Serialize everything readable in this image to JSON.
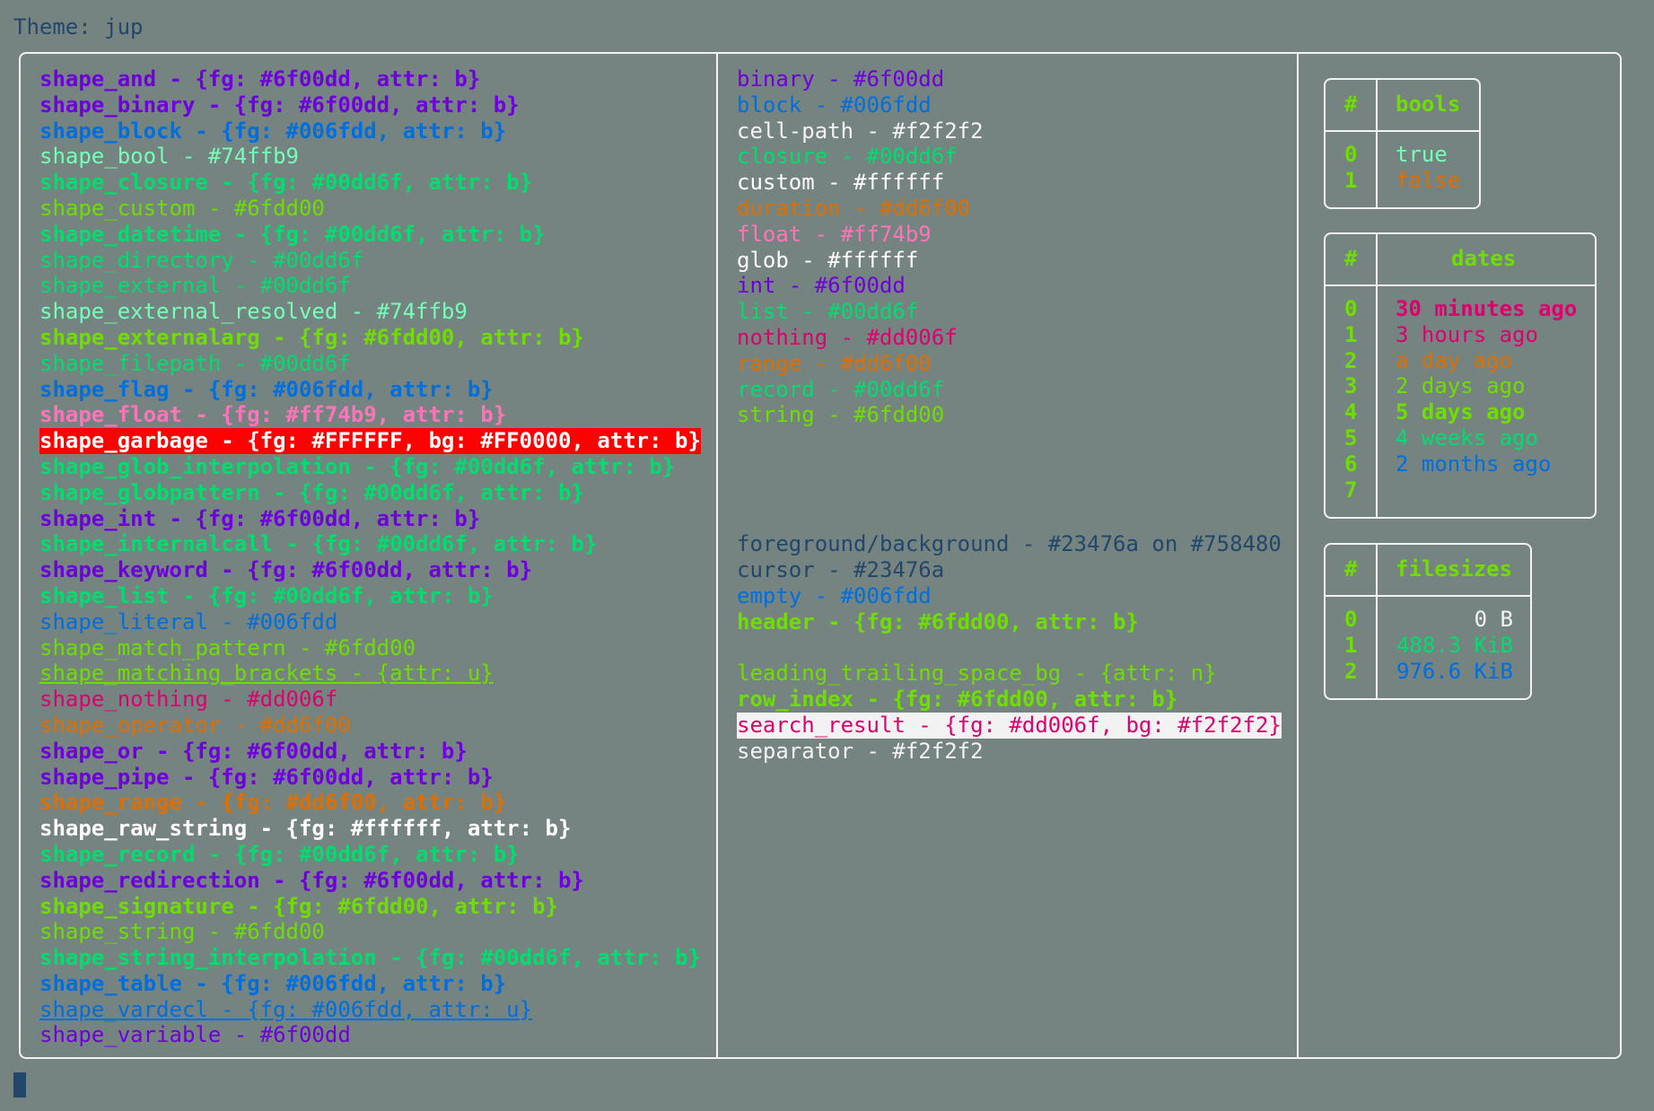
{
  "theme_line": "Theme: jup",
  "left_items": [
    {
      "text": "shape_and - {fg: #6f00dd, attr: b}",
      "color": "#6f00dd",
      "bold": true
    },
    {
      "text": "shape_binary - {fg: #6f00dd, attr: b}",
      "color": "#6f00dd",
      "bold": true
    },
    {
      "text": "shape_block - {fg: #006fdd, attr: b}",
      "color": "#006fdd",
      "bold": true
    },
    {
      "text": "shape_bool - #74ffb9",
      "color": "#74ffb9"
    },
    {
      "text": "shape_closure - {fg: #00dd6f, attr: b}",
      "color": "#00dd6f",
      "bold": true
    },
    {
      "text": "shape_custom - #6fdd00",
      "color": "#6fdd00"
    },
    {
      "text": "shape_datetime - {fg: #00dd6f, attr: b}",
      "color": "#00dd6f",
      "bold": true
    },
    {
      "text": "shape_directory - #00dd6f",
      "color": "#00dd6f"
    },
    {
      "text": "shape_external - #00dd6f",
      "color": "#00dd6f"
    },
    {
      "text": "shape_external_resolved - #74ffb9",
      "color": "#74ffb9"
    },
    {
      "text": "shape_externalarg - {fg: #6fdd00, attr: b}",
      "color": "#6fdd00",
      "bold": true
    },
    {
      "text": "shape_filepath - #00dd6f",
      "color": "#00dd6f"
    },
    {
      "text": "shape_flag - {fg: #006fdd, attr: b}",
      "color": "#006fdd",
      "bold": true
    },
    {
      "text": "shape_float - {fg: #ff74b9, attr: b}",
      "color": "#ff74b9",
      "bold": true
    },
    {
      "text": "shape_garbage - {fg: #FFFFFF, bg: #FF0000, attr: b}",
      "color": "#FFFFFF",
      "bg": "#FF0000",
      "bold": true
    },
    {
      "text": "shape_glob_interpolation - {fg: #00dd6f, attr: b}",
      "color": "#00dd6f",
      "bold": true
    },
    {
      "text": "shape_globpattern - {fg: #00dd6f, attr: b}",
      "color": "#00dd6f",
      "bold": true
    },
    {
      "text": "shape_int - {fg: #6f00dd, attr: b}",
      "color": "#6f00dd",
      "bold": true
    },
    {
      "text": "shape_internalcall - {fg: #00dd6f, attr: b}",
      "color": "#00dd6f",
      "bold": true
    },
    {
      "text": "shape_keyword - {fg: #6f00dd, attr: b}",
      "color": "#6f00dd",
      "bold": true
    },
    {
      "text": "shape_list - {fg: #00dd6f, attr: b}",
      "color": "#00dd6f",
      "bold": true
    },
    {
      "text": "shape_literal - #006fdd",
      "color": "#006fdd"
    },
    {
      "text": "shape_match_pattern - #6fdd00",
      "color": "#6fdd00"
    },
    {
      "text": "shape_matching_brackets - {attr: u}",
      "color": "#6fdd00",
      "underline": true
    },
    {
      "text": "shape_nothing - #dd006f",
      "color": "#dd006f"
    },
    {
      "text": "shape_operator - #dd6f00",
      "color": "#dd6f00"
    },
    {
      "text": "shape_or - {fg: #6f00dd, attr: b}",
      "color": "#6f00dd",
      "bold": true
    },
    {
      "text": "shape_pipe - {fg: #6f00dd, attr: b}",
      "color": "#6f00dd",
      "bold": true
    },
    {
      "text": "shape_range - {fg: #dd6f00, attr: b}",
      "color": "#dd6f00",
      "bold": true
    },
    {
      "text": "shape_raw_string - {fg: #ffffff, attr: b}",
      "color": "#ffffff",
      "bold": true
    },
    {
      "text": "shape_record - {fg: #00dd6f, attr: b}",
      "color": "#00dd6f",
      "bold": true
    },
    {
      "text": "shape_redirection - {fg: #6f00dd, attr: b}",
      "color": "#6f00dd",
      "bold": true
    },
    {
      "text": "shape_signature - {fg: #6fdd00, attr: b}",
      "color": "#6fdd00",
      "bold": true
    },
    {
      "text": "shape_string - #6fdd00",
      "color": "#6fdd00"
    },
    {
      "text": "shape_string_interpolation - {fg: #00dd6f, attr: b}",
      "color": "#00dd6f",
      "bold": true
    },
    {
      "text": "shape_table - {fg: #006fdd, attr: b}",
      "color": "#006fdd",
      "bold": true
    },
    {
      "text": "shape_vardecl - {fg: #006fdd, attr: u}",
      "color": "#006fdd",
      "underline": true
    },
    {
      "text": "shape_variable - #6f00dd",
      "color": "#6f00dd"
    }
  ],
  "middle_items": [
    {
      "text": "binary - #6f00dd",
      "color": "#6f00dd"
    },
    {
      "text": "block - #006fdd",
      "color": "#006fdd"
    },
    {
      "text": "cell-path - #f2f2f2",
      "color": "#f2f2f2"
    },
    {
      "text": "closure - #00dd6f",
      "color": "#00dd6f"
    },
    {
      "text": "custom - #ffffff",
      "color": "#ffffff"
    },
    {
      "text": "duration - #dd6f00",
      "color": "#dd6f00"
    },
    {
      "text": "float - #ff74b9",
      "color": "#ff74b9"
    },
    {
      "text": "glob - #ffffff",
      "color": "#ffffff"
    },
    {
      "text": "int - #6f00dd",
      "color": "#6f00dd"
    },
    {
      "text": "list - #00dd6f",
      "color": "#00dd6f"
    },
    {
      "text": "nothing - #dd006f",
      "color": "#dd006f"
    },
    {
      "text": "range - #dd6f00",
      "color": "#dd6f00"
    },
    {
      "text": "record - #00dd6f",
      "color": "#00dd6f"
    },
    {
      "text": "string - #6fdd00",
      "color": "#6fdd00"
    },
    {
      "text": "",
      "color": "#23476a"
    },
    {
      "text": "",
      "color": "#23476a"
    },
    {
      "text": "",
      "color": "#23476a"
    },
    {
      "text": "",
      "color": "#23476a"
    },
    {
      "text": "foreground/background - #23476a on #758480",
      "color": "#23476a"
    },
    {
      "text": "cursor - #23476a",
      "color": "#23476a"
    },
    {
      "text": "empty - #006fdd",
      "color": "#006fdd"
    },
    {
      "text": "header - {fg: #6fdd00, attr: b}",
      "color": "#6fdd00",
      "bold": true
    },
    {
      "text": "",
      "color": "#23476a"
    },
    {
      "text": "leading_trailing_space_bg - {attr: n}",
      "color": "#6fdd00"
    },
    {
      "text": "row_index - {fg: #6fdd00, attr: b}",
      "color": "#6fdd00",
      "bold": true
    },
    {
      "text": "search_result - {fg: #dd006f, bg: #f2f2f2}",
      "color": "#dd006f",
      "bg": "#f2f2f2"
    },
    {
      "text": "separator - #f2f2f2",
      "color": "#f2f2f2"
    }
  ],
  "bools_table": {
    "header_index": "#",
    "header_value": "bools",
    "rows": [
      {
        "index": "0",
        "value": "true",
        "color": "#74ffb9"
      },
      {
        "index": "1",
        "value": "false",
        "color": "#dd6f00"
      }
    ]
  },
  "dates_table": {
    "header_index": "#",
    "header_value": "dates",
    "rows": [
      {
        "index": "0",
        "value": "30 minutes ago",
        "color": "#dd006f",
        "bold": true
      },
      {
        "index": "1",
        "value": "3 hours ago",
        "color": "#dd006f"
      },
      {
        "index": "2",
        "value": "a day ago",
        "color": "#dd6f00"
      },
      {
        "index": "3",
        "value": "2 days ago",
        "color": "#6fdd00"
      },
      {
        "index": "4",
        "value": "5 days ago",
        "color": "#6fdd00",
        "bold": true
      },
      {
        "index": "5",
        "value": "4 weeks ago",
        "color": "#00dd6f"
      },
      {
        "index": "6",
        "value": "2 months ago",
        "color": "#006fdd"
      },
      {
        "index": "7",
        "value": "",
        "color": "#006fdd"
      }
    ]
  },
  "filesizes_table": {
    "header_index": "#",
    "header_value": "filesizes",
    "rows": [
      {
        "index": "0",
        "value": "0 B",
        "color": "#f2f2f2"
      },
      {
        "index": "1",
        "value": "488.3 KiB",
        "color": "#00dd6f"
      },
      {
        "index": "2",
        "value": "976.6 KiB",
        "color": "#006fdd"
      }
    ]
  }
}
